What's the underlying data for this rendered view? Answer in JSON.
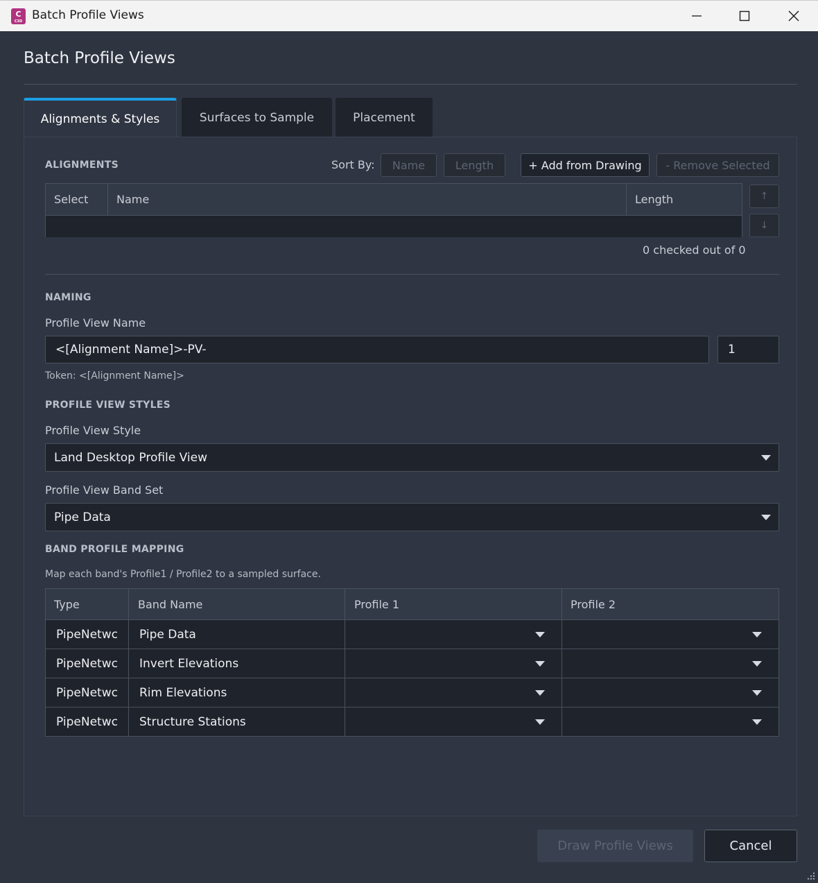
{
  "window": {
    "icon_letter": "C",
    "icon_sub": "C3D",
    "title": "Batch Profile Views"
  },
  "dialog": {
    "title": "Batch Profile Views"
  },
  "tabs": [
    {
      "label": "Alignments & Styles",
      "active": true
    },
    {
      "label": "Surfaces to Sample",
      "active": false
    },
    {
      "label": "Placement",
      "active": false
    }
  ],
  "alignments": {
    "section_label": "ALIGNMENTS",
    "sort_by_label": "Sort By:",
    "sort_name_label": "Name",
    "sort_length_label": "Length",
    "add_label": "+ Add from Drawing",
    "remove_label": "- Remove Selected",
    "columns": [
      "Select",
      "Name",
      "Length"
    ],
    "move_up_glyph": "↑",
    "move_down_glyph": "↓",
    "status": "0 checked out of 0"
  },
  "naming": {
    "section_label": "NAMING",
    "field_label": "Profile View Name",
    "value": "<[Alignment Name]>-PV-",
    "counter": "1",
    "token_hint": "Token: <[Alignment Name]>"
  },
  "styles": {
    "section_label": "PROFILE VIEW STYLES",
    "style_label": "Profile View Style",
    "style_value": "Land Desktop Profile View",
    "band_set_label": "Profile View Band Set",
    "band_set_value": "Pipe Data"
  },
  "mapping": {
    "section_label": "BAND PROFILE MAPPING",
    "hint": "Map each band's Profile1 / Profile2 to a sampled surface.",
    "columns": [
      "Type",
      "Band Name",
      "Profile 1",
      "Profile 2"
    ],
    "rows": [
      {
        "type": "PipeNetwc",
        "band": "Pipe Data",
        "profile1": "",
        "profile2": ""
      },
      {
        "type": "PipeNetwc",
        "band": "Invert Elevations",
        "profile1": "",
        "profile2": ""
      },
      {
        "type": "PipeNetwc",
        "band": "Rim Elevations",
        "profile1": "",
        "profile2": ""
      },
      {
        "type": "PipeNetwc",
        "band": "Structure Stations",
        "profile1": "",
        "profile2": ""
      }
    ]
  },
  "footer": {
    "draw_label": "Draw Profile Views",
    "cancel_label": "Cancel"
  },
  "colors": {
    "accent": "#1d9ee6",
    "background": "#2e3440",
    "field": "#1f232b",
    "app_icon": "#b0337f"
  }
}
